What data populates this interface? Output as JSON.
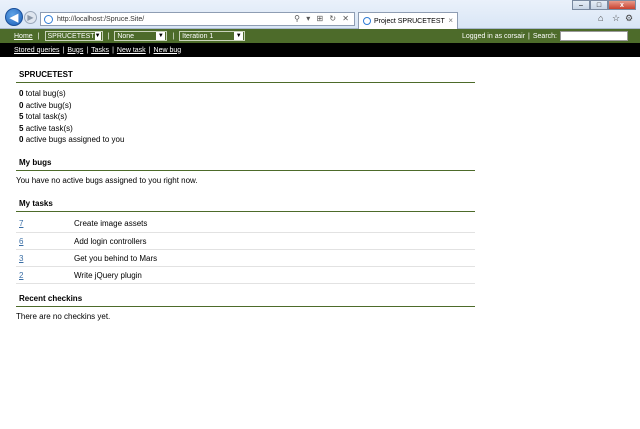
{
  "browser": {
    "url": "http://localhost:/Spruce.Site/",
    "tab_title": "Project SPRUCETEST",
    "tab_close": "×",
    "addr_tools": "⚲ ▾ ⊞ ↻ ✕"
  },
  "nav": {
    "home": "Home",
    "project": "SPRUCETEST",
    "filter": "None",
    "iteration": "Iteration 1",
    "logged_in": "Logged in as corsair",
    "search_label": "Search:",
    "search_value": ""
  },
  "subnav": {
    "stored_queries": "Stored queries",
    "bugs": "Bugs",
    "tasks": "Tasks",
    "new_task": "New task",
    "new_bug": "New bug"
  },
  "project": {
    "title": "SPRUCETEST",
    "stats": [
      {
        "count": "0",
        "label": "total bug(s)"
      },
      {
        "count": "0",
        "label": "active bug(s)"
      },
      {
        "count": "5",
        "label": "total task(s)"
      },
      {
        "count": "5",
        "label": "active task(s)"
      },
      {
        "count": "0",
        "label": "active bugs assigned to you"
      }
    ]
  },
  "my_bugs": {
    "title": "My bugs",
    "message": "You have no active bugs assigned to you right now."
  },
  "my_tasks": {
    "title": "My tasks",
    "rows": [
      {
        "id": "7",
        "name": "Create image assets"
      },
      {
        "id": "6",
        "name": "Add login controllers"
      },
      {
        "id": "3",
        "name": "Get you behind to Mars"
      },
      {
        "id": "2",
        "name": "Write jQuery plugin"
      }
    ]
  },
  "checkins": {
    "title": "Recent checkins",
    "message": "There are no checkins yet."
  }
}
